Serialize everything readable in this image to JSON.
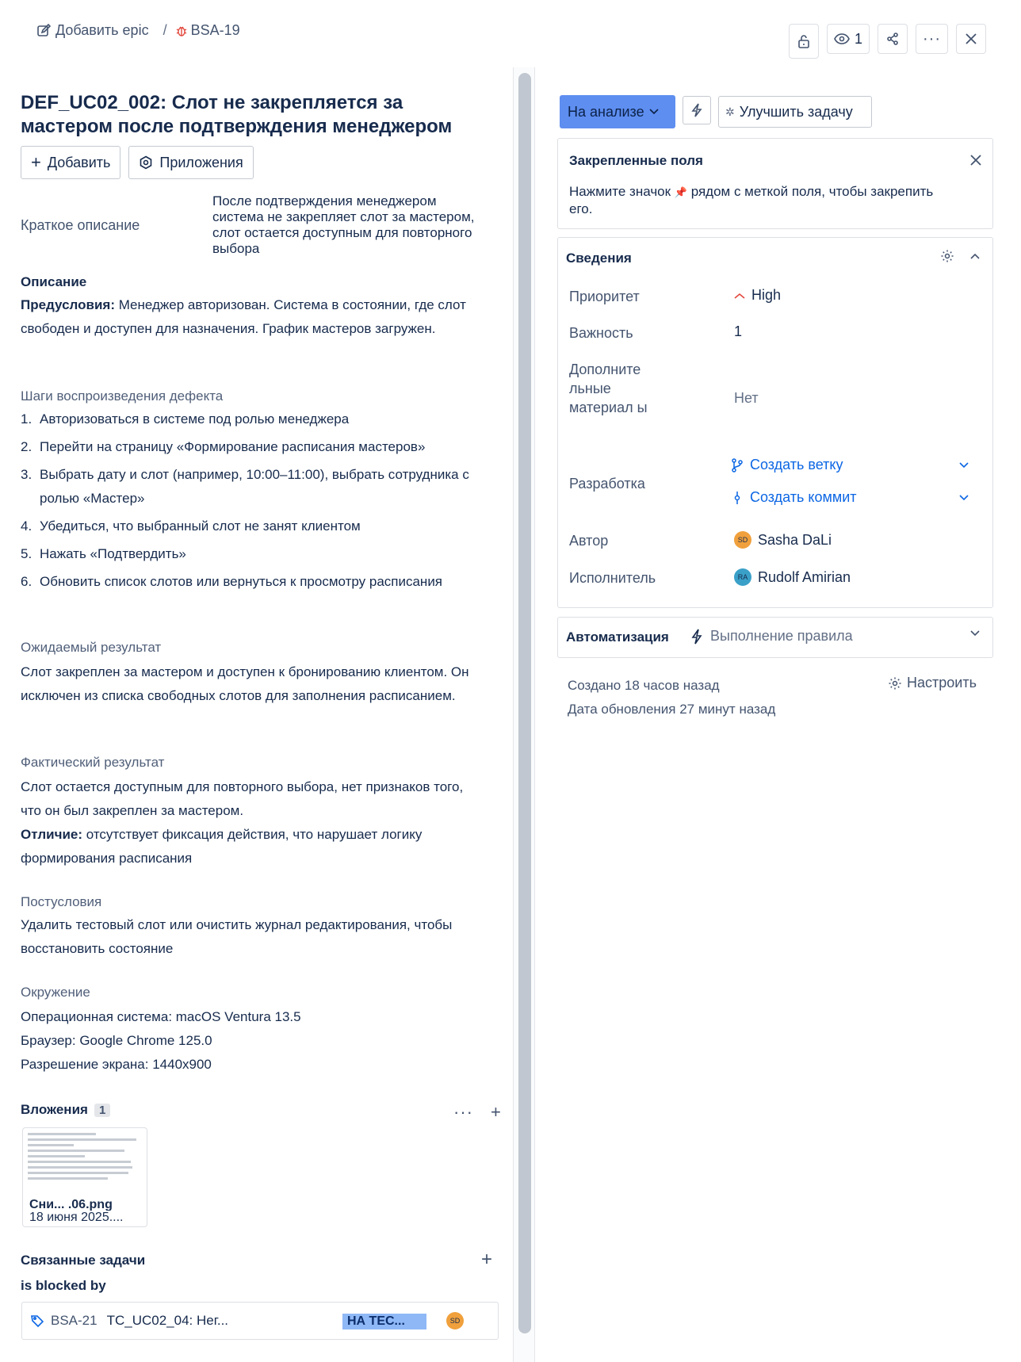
{
  "breadcrumb": {
    "add_epic": "Добавить epic",
    "separator": "/",
    "issue_key": "BSA-19"
  },
  "toolbar": {
    "watchers_count": "1"
  },
  "issue": {
    "title": "DEF_UC02_002: Слот не закрепляется за мастером после подтверждения менеджером",
    "add_label": "Добавить",
    "apps_label": "Приложения",
    "summary_label": "Краткое описание",
    "summary_value": "После подтверждения менеджером система не закрепляет слот за мастером, слот остается доступным для повторного выбора",
    "description_heading": "Описание",
    "preconditions_label": "Предусловия:",
    "preconditions_text": " Менеджер авторизован. Система в состоянии, где слот свободен и доступен для назначения. График мастеров загружен.",
    "steps_heading": "Шаги воспроизведения дефекта",
    "steps": [
      {
        "n": "1.",
        "text": "Авторизоваться в системе под ролью менеджера"
      },
      {
        "n": "2.",
        "text": "Перейти на страницу «Формирование расписания мастеров»"
      },
      {
        "n": "3.",
        "text": "Выбрать дату и слот (например, 10:00–11:00), выбрать сотрудника с ролью «Мастер»"
      },
      {
        "n": "4.",
        "text": "Убедиться, что выбранный слот не занят клиентом"
      },
      {
        "n": "5.",
        "text": "Нажать «Подтвердить»"
      },
      {
        "n": "6.",
        "text": "Обновить список слотов или вернуться к просмотру расписания"
      }
    ],
    "expected_heading": "Ожидаемый результат",
    "expected_text": "Слот закреплен за мастером и доступен к бронированию клиентом. Он исключен из списка свободных слотов для заполнения расписанием.",
    "actual_heading": "Фактический результат",
    "actual_text": "Слот остается доступным для повторного выбора, нет признаков того, что он был закреплен за мастером.",
    "difference_label": "Отличие:",
    "difference_text": " отсутствует фиксация действия, что нарушает логику формирования расписания",
    "postconditions_heading": "Постусловия",
    "postconditions_text": "Удалить тестовый слот или очистить журнал редактирования, чтобы восстановить состояние",
    "environment_heading": "Окружение",
    "environment_lines": [
      "Операционная система: macOS Ventura 13.5",
      "Браузер: Google Chrome 125.0",
      "Разрешение экрана: 1440x900"
    ]
  },
  "attachments": {
    "heading": "Вложения",
    "count": "1",
    "file_name": "Сни... .06.png",
    "file_date": "18 июня 2025...."
  },
  "linked": {
    "heading": "Связанные задачи",
    "relation": "is blocked by",
    "items": [
      {
        "key": "BSA-21",
        "summary": "TC_UC02_04: Нег...",
        "status": "НА ТЕС...",
        "assignee_initials": "SD"
      }
    ]
  },
  "right": {
    "status": "На анализе",
    "improve_label": "Улучшить задачу",
    "pinned_heading": "Закрепленные поля",
    "pinned_text_before": "Нажмите значок ",
    "pinned_text_after": " рядом с меткой поля, чтобы закрепить его.",
    "details_heading": "Сведения",
    "fields": {
      "priority_label": "Приоритет",
      "priority_value": "High",
      "importance_label": "Важность",
      "importance_value": "1",
      "extra_label": "Дополните льные материал ы",
      "extra_value": "Нет",
      "dev_label": "Разработка",
      "create_branch": "Создать ветку",
      "create_commit": "Создать коммит",
      "author_label": "Автор",
      "author_initials": "SD",
      "author_name": "Sasha DaLi",
      "assignee_label": "Исполнитель",
      "assignee_initials": "RA",
      "assignee_name": "Rudolf Amirian"
    },
    "automation_heading": "Автоматизация",
    "automation_rule": "Выполнение правила",
    "created": "Создано 18 часов назад",
    "updated": "Дата обновления 27 минут назад",
    "configure": "Настроить"
  },
  "colors": {
    "status_bg": "#5e8ef0",
    "link": "#0c66e4",
    "author_avatar": "#f0a03c",
    "assignee_avatar": "#3aa0c8",
    "priority_high": "#e2483d"
  }
}
